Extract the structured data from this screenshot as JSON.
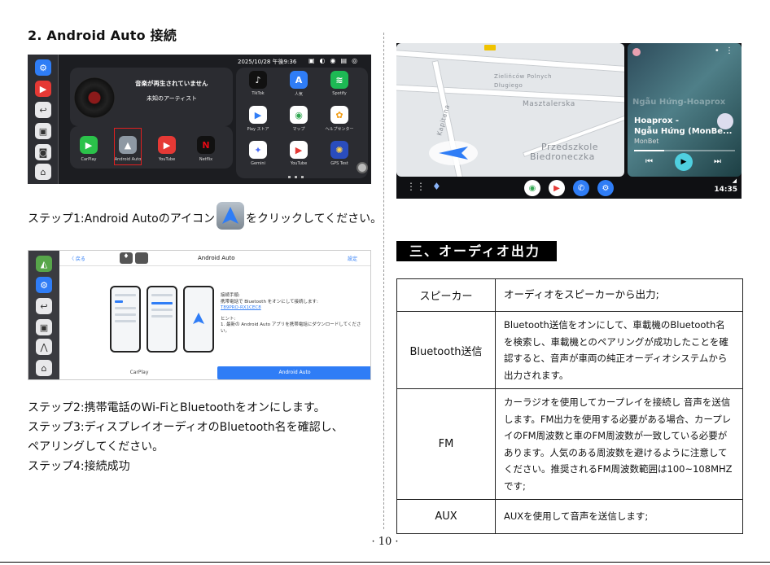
{
  "section_title": "2. Android Auto 接続",
  "screen1": {
    "status_time": "2025/10/28 午後9:36",
    "now_playing": "音楽が再生されていません",
    "artist": "未知のアーティスト",
    "dock_apps": [
      "CarPlay",
      "Android Auto",
      "YouTube",
      "Netflix"
    ],
    "grid_apps": [
      "TikTok",
      "人気",
      "Spotify",
      "Play ストア",
      "マップ",
      "ヘルプセンター",
      "Gemini",
      "YouTube",
      "GPS Test"
    ]
  },
  "step1_before": "ステップ1:Android Autoのアイコン",
  "step1_after": "をクリックしてください。",
  "screen2": {
    "back": "〈 戻る",
    "title": "Android Auto",
    "settings": "設定",
    "guide_title": "接続手順:",
    "guide_line": "携帯電話で Bluetooth をオンにして接続します:",
    "device": "T89PRO-RX1CEC8",
    "hint_title": "ヒント:",
    "hint_line": "1. 最新の Android Auto アプリを携帯電話にダウンロードしてください。",
    "tab_left": "CarPlay",
    "tab_right": "Android Auto"
  },
  "steps": [
    "ステップ2:携帯電話のWi-FiとBluetoothをオンにします。",
    "ステップ3:ディスプレイオーディオのBluetooth名を確認し、",
    "ペアリングしてください。",
    "ステップ4:接続成功"
  ],
  "screen3": {
    "map_labels": [
      "Zielińców Polnych",
      "Długiego",
      "Masztalerska",
      "Przedszkole",
      "Biedroneczka",
      "Kapitana"
    ],
    "track_title": "Hoaprox -",
    "track_subtitle": "Ngẫu Hứng (MonBe...",
    "track_artist": "MonBet",
    "banner": "Ngẫu Hứng-Hoaprox",
    "clock": "14:35"
  },
  "audio_heading": "三、オーディオ出力",
  "table": [
    {
      "key": "スピーカー",
      "value": "オーディオをスピーカーから出力;"
    },
    {
      "key": "Bluetooth送信",
      "value": "Bluetooth送信をオンにして、車載機のBluetooth名を検索し、車載機とのペアリングが成功したことを確認すると、音声が車両の純正オーディオシステムから出力されます。"
    },
    {
      "key": "FM",
      "value": "カーラジオを使用してカープレイを接続し 音声を送信します。FM出力を使用する必要がある場合、カープレイのFM周波数と車のFM周波数が一致している必要があります。人気のある周波数を避けるように注意してください。推奨されるFM周波数範囲は100~108MHZです;"
    },
    {
      "key": "AUX",
      "value": "AUXを使用して音声を送信します;"
    }
  ],
  "page_number": "· 10 ·",
  "colors": {
    "accent_blue": "#2f7df6",
    "highlight_red": "#e02020"
  }
}
